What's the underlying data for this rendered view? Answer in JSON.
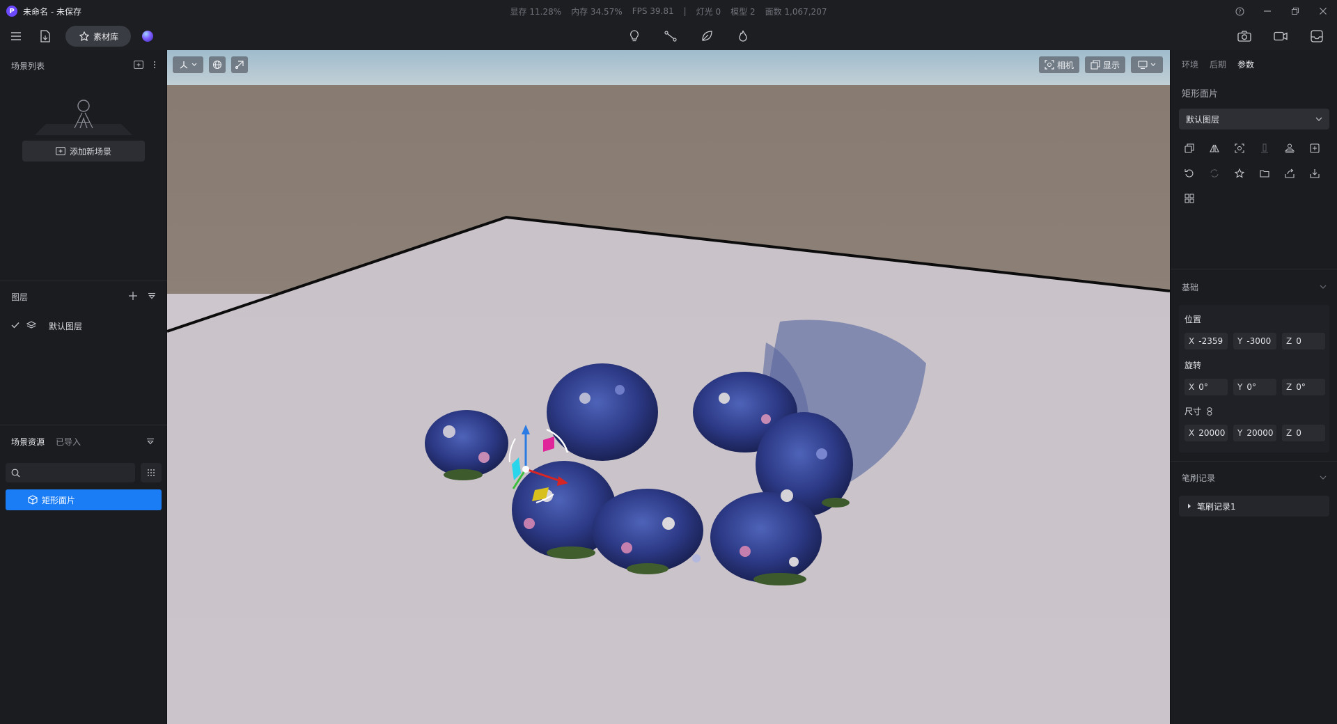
{
  "window": {
    "title": "未命名 - 未保存",
    "logo_letter": "P"
  },
  "stats": {
    "vram": "显存 11.28%",
    "memory": "内存 34.57%",
    "fps": "FPS 39.81",
    "separator": "|",
    "lights": "灯光 0",
    "models": "模型 2",
    "faces": "面数 1,067,207"
  },
  "toolbar": {
    "library_label": "素材库"
  },
  "left_panel": {
    "scene_list": {
      "title": "场景列表",
      "add_scene_label": "添加新场景"
    },
    "layers": {
      "title": "图层",
      "items": [
        {
          "label": "默认图层",
          "checked": true
        }
      ]
    },
    "assets": {
      "tabs": [
        {
          "label": "场景资源",
          "active": true
        },
        {
          "label": "已导入",
          "active": false
        }
      ],
      "search_placeholder": "",
      "items": [
        {
          "label": "矩形面片",
          "selected": true
        }
      ]
    }
  },
  "viewport": {
    "camera_label": "相机",
    "display_label": "显示"
  },
  "right_panel": {
    "tabs": [
      {
        "label": "环境",
        "active": false
      },
      {
        "label": "后期",
        "active": false
      },
      {
        "label": "参数",
        "active": true
      }
    ],
    "object_title": "矩形面片",
    "layer_select": "默认图层",
    "basic": {
      "title": "基础",
      "position": {
        "label": "位置",
        "x": "X",
        "x_val": "-2359",
        "y": "Y",
        "y_val": "-3000",
        "z": "Z",
        "z_val": "0"
      },
      "rotation": {
        "label": "旋转",
        "x": "X",
        "x_val": "0°",
        "y": "Y",
        "y_val": "0°",
        "z": "Z",
        "z_val": "0°"
      },
      "size": {
        "label": "尺寸",
        "x": "X",
        "x_val": "20000",
        "y": "Y",
        "y_val": "20000",
        "z": "Z",
        "z_val": "0"
      }
    },
    "brush": {
      "title": "笔刷记录",
      "items": [
        {
          "label": "笔刷记录1"
        }
      ]
    }
  },
  "colors": {
    "accent": "#1a7df5",
    "panel_bg": "#1b1c20",
    "ground": "#cdc6cc",
    "wall": "#8c7f75",
    "sky": "#a9c2d2"
  }
}
